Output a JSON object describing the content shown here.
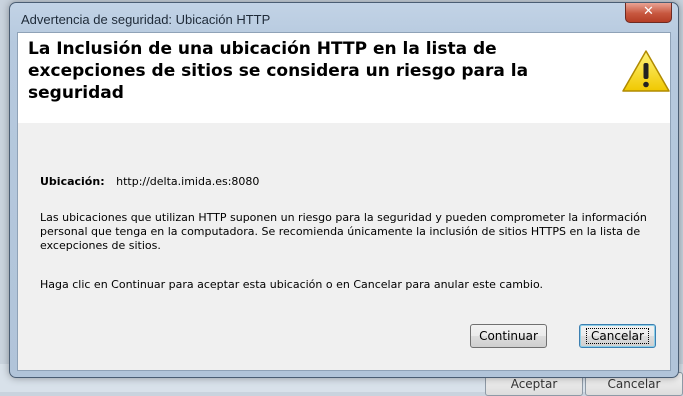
{
  "background_window": {
    "accept_label": "Aceptar",
    "cancel_label": "Cancelar"
  },
  "dialog": {
    "title": "Advertencia de seguridad: Ubicación HTTP",
    "close_glyph": "✕",
    "header_text": "La Inclusión de una ubicación HTTP en la lista de excepciones de sitios se considera un riesgo para la seguridad",
    "location_label": "Ubicación:",
    "location_value": "http://delta.imida.es:8080",
    "paragraph1": "Las ubicaciones que utilizan HTTP suponen un riesgo para la seguridad y pueden comprometer la información personal que tenga en la computadora. Se recomienda únicamente la inclusión de sitios HTTPS en la lista de excepciones de sitios.",
    "paragraph2": "Haga clic en Continuar para aceptar esta ubicación o en Cancelar para anular este cambio.",
    "continue_label": "Continuar",
    "cancel_label": "Cancelar",
    "warning_icon": "warning-triangle-icon"
  },
  "colors": {
    "title_bar": "#b6c9de",
    "close_button": "#c7573f",
    "warning_yellow": "#f5d90a"
  }
}
